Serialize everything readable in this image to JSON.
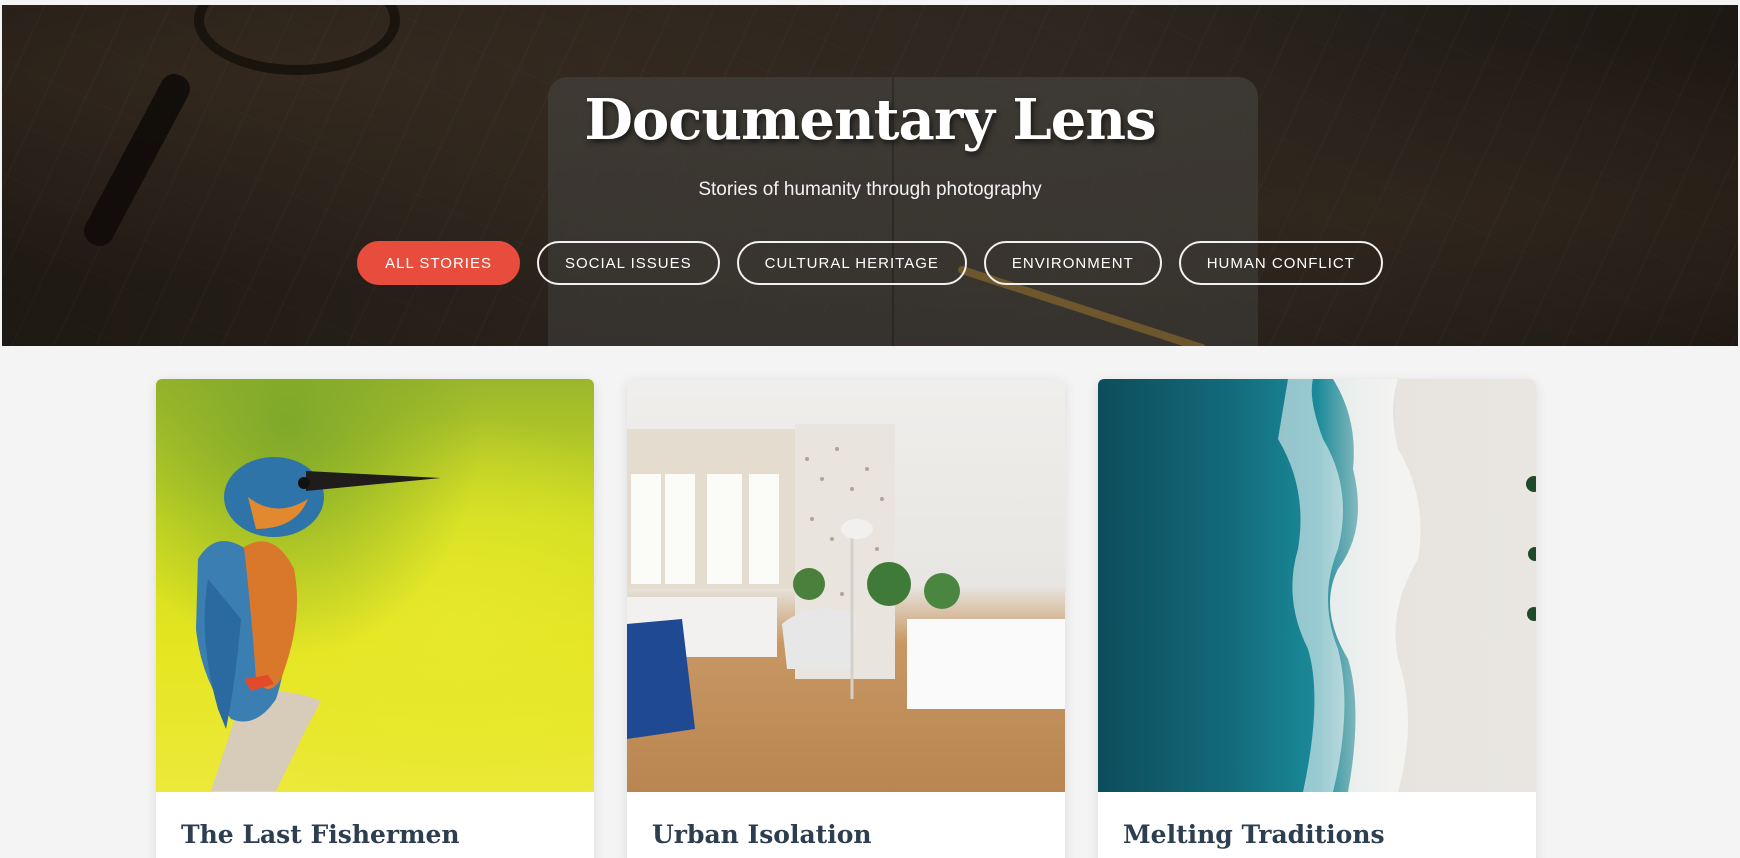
{
  "hero": {
    "title": "Documentary Lens",
    "subtitle": "Stories of humanity through photography"
  },
  "filters": [
    {
      "label": "ALL STORIES",
      "active": true
    },
    {
      "label": "SOCIAL ISSUES",
      "active": false
    },
    {
      "label": "CULTURAL HERITAGE",
      "active": false
    },
    {
      "label": "ENVIRONMENT",
      "active": false
    },
    {
      "label": "HUMAN CONFLICT",
      "active": false
    }
  ],
  "stories": [
    {
      "title": "The Last Fishermen",
      "image": "kingfisher-photo"
    },
    {
      "title": "Urban Isolation",
      "image": "interior-room-photo"
    },
    {
      "title": "Melting Traditions",
      "image": "aerial-ocean-beach-photo"
    }
  ],
  "colors": {
    "accent": "#e74c3c",
    "title_text": "#2c3e50",
    "page_background": "#f4f4f4"
  }
}
